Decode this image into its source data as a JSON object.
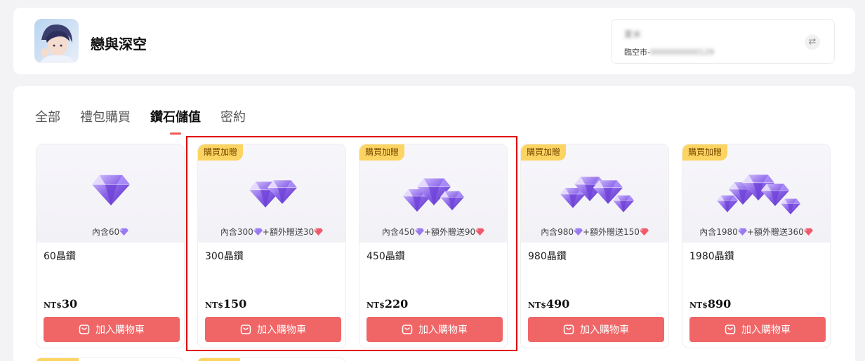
{
  "game": {
    "title": "戀與深空"
  },
  "account": {
    "name": "夏米",
    "server_label": "臨空市-",
    "server_id": "0000000000129"
  },
  "tabs": [
    {
      "label": "全部",
      "active": false
    },
    {
      "label": "禮包購買",
      "active": false
    },
    {
      "label": "鑽石儲值",
      "active": true
    },
    {
      "label": "密約",
      "active": false
    }
  ],
  "currency": "NT$",
  "cart_label": "加入購物車",
  "accent_color": "#f06566",
  "products": [
    {
      "badge": "",
      "contains_prefix": "內含60",
      "bonus": "",
      "name": "60晶鑽",
      "price": "30",
      "gems": 1
    },
    {
      "badge": "購買加贈",
      "contains_prefix": "內含300",
      "bonus": "+額外贈送30",
      "name": "300晶鑽",
      "price": "150",
      "gems": 2
    },
    {
      "badge": "購買加贈",
      "contains_prefix": "內含450",
      "bonus": "+額外贈送90",
      "name": "450晶鑽",
      "price": "220",
      "gems": 3
    },
    {
      "badge": "購買加贈",
      "contains_prefix": "內含980",
      "bonus": "+額外贈送150",
      "name": "980晶鑽",
      "price": "490",
      "gems": 4
    },
    {
      "badge": "購買加贈",
      "contains_prefix": "內含1980",
      "bonus": "+額外贈送360",
      "name": "1980晶鑽",
      "price": "890",
      "gems": 5
    }
  ]
}
